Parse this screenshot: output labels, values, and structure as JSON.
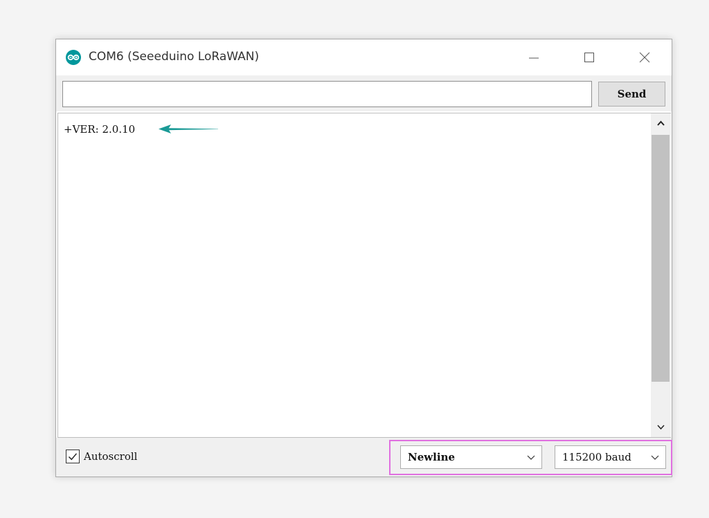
{
  "window": {
    "title": "COM6 (Seeeduino LoRaWAN)"
  },
  "input": {
    "value": "",
    "send_label": "Send"
  },
  "output": {
    "lines": [
      "+VER: 2.0.10"
    ]
  },
  "bottom": {
    "autoscroll_label": "Autoscroll",
    "autoscroll_checked": true,
    "line_ending_selected": "Newline",
    "baud_rate_selected": "115200 baud"
  },
  "colors": {
    "arrow": "#1a9a96",
    "highlight": "#e070e0",
    "app_icon": "#00979c"
  },
  "icons": [
    "arduino-logo-icon",
    "minimize-icon",
    "maximize-icon",
    "close-icon",
    "arrow-left-icon",
    "scroll-up-icon",
    "scroll-down-icon",
    "checkmark-icon",
    "chevron-down-icon"
  ]
}
